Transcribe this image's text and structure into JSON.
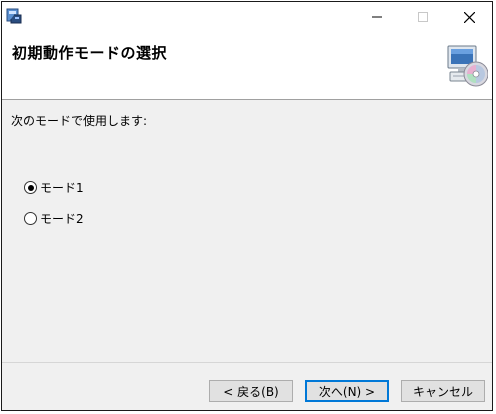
{
  "window": {
    "title_bar_icon": "installer-icon",
    "minimize_icon": "minimize-icon",
    "maximize_icon": "maximize-icon",
    "close_icon": "close-icon"
  },
  "header": {
    "title": "初期動作モードの選択",
    "icon": "computer-cd-icon"
  },
  "main": {
    "instruction": "次のモードで使用します:",
    "options": [
      {
        "label": "モード1",
        "selected": true
      },
      {
        "label": "モード2",
        "selected": false
      }
    ]
  },
  "footer": {
    "back_label": "< 戻る(B)",
    "next_label": "次へ(N) >",
    "cancel_label": "キャンセル"
  },
  "colors": {
    "accent": "#0078d7",
    "dialog_background": "#f0f0f0",
    "header_background": "#ffffff"
  }
}
